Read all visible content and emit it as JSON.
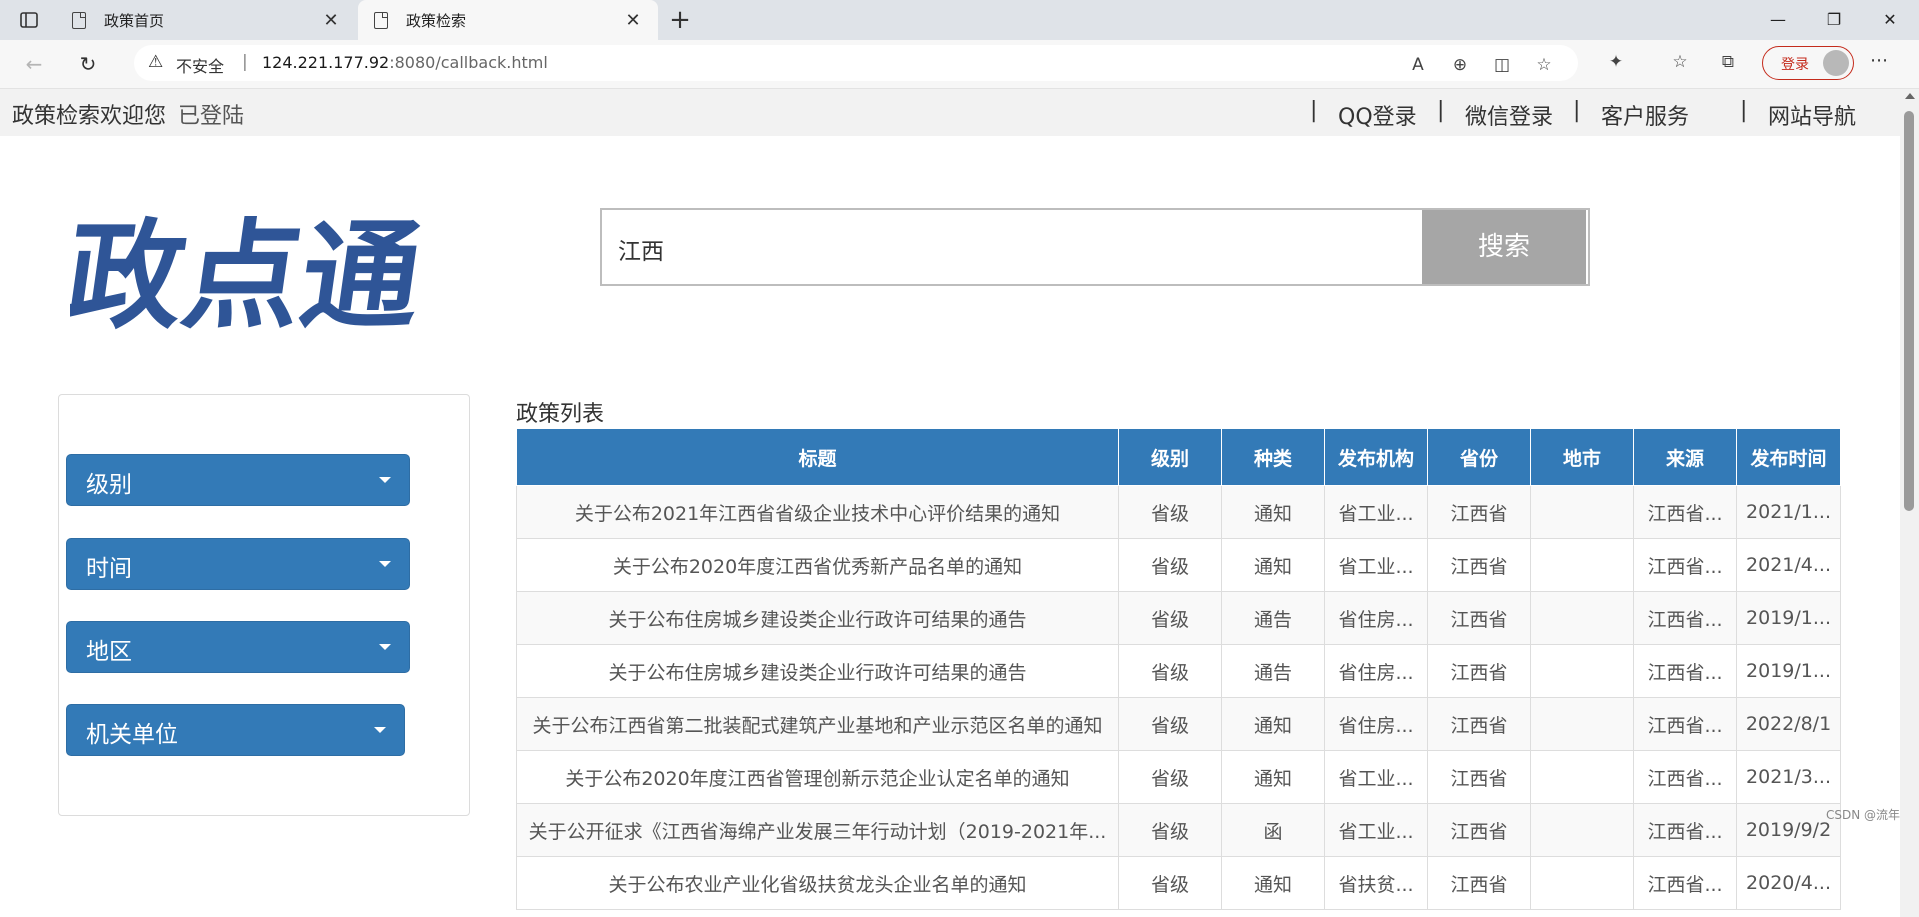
{
  "browser": {
    "tabs": [
      {
        "label": "政策首页",
        "active": false
      },
      {
        "label": "政策检索",
        "active": true
      }
    ],
    "address": {
      "security_label": "不安全",
      "host": "124.221.177.92",
      "rest": ":8080/callback.html"
    },
    "login_label": "登录"
  },
  "page": {
    "topnav": {
      "welcome": "政策检索欢迎您",
      "status": "已登陆",
      "links": [
        "QQ登录",
        "微信登录",
        "客户服务",
        "网站导航"
      ]
    },
    "logo_text": "政点通",
    "search": {
      "value": "江西",
      "button_label": "搜索"
    },
    "filters": [
      "级别",
      "时间",
      "地区",
      "机关单位"
    ],
    "list_title": "政策列表",
    "table": {
      "headers": [
        "标题",
        "级别",
        "种类",
        "发布机构",
        "省份",
        "地市",
        "来源",
        "发布时间"
      ],
      "rows": [
        [
          "关于公布2021年江西省省级企业技术中心评价结果的通知",
          "省级",
          "通知",
          "省工业...",
          "江西省",
          "",
          "江西省...",
          "2021/1..."
        ],
        [
          "关于公布2020年度江西省优秀新产品名单的通知",
          "省级",
          "通知",
          "省工业...",
          "江西省",
          "",
          "江西省...",
          "2021/4..."
        ],
        [
          "关于公布住房城乡建设类企业行政许可结果的通告",
          "省级",
          "通告",
          "省住房...",
          "江西省",
          "",
          "江西省...",
          "2019/1..."
        ],
        [
          "关于公布住房城乡建设类企业行政许可结果的通告",
          "省级",
          "通告",
          "省住房...",
          "江西省",
          "",
          "江西省...",
          "2019/1..."
        ],
        [
          "关于公布江西省第二批装配式建筑产业基地和产业示范区名单的通知",
          "省级",
          "通知",
          "省住房...",
          "江西省",
          "",
          "江西省...",
          "2022/8/1"
        ],
        [
          "关于公布2020年度江西省管理创新示范企业认定名单的通知",
          "省级",
          "通知",
          "省工业...",
          "江西省",
          "",
          "江西省...",
          "2021/3..."
        ],
        [
          "关于公开征求《江西省海绵产业发展三年行动计划（2019-2021年...",
          "省级",
          "函",
          "省工业...",
          "江西省",
          "",
          "江西省...",
          "2019/9/2"
        ],
        [
          "关于公布农业产业化省级扶贫龙头企业名单的通知",
          "省级",
          "通知",
          "省扶贫...",
          "江西省",
          "",
          "江西省...",
          "2020/4..."
        ]
      ]
    },
    "watermark": "CSDN @流年"
  }
}
